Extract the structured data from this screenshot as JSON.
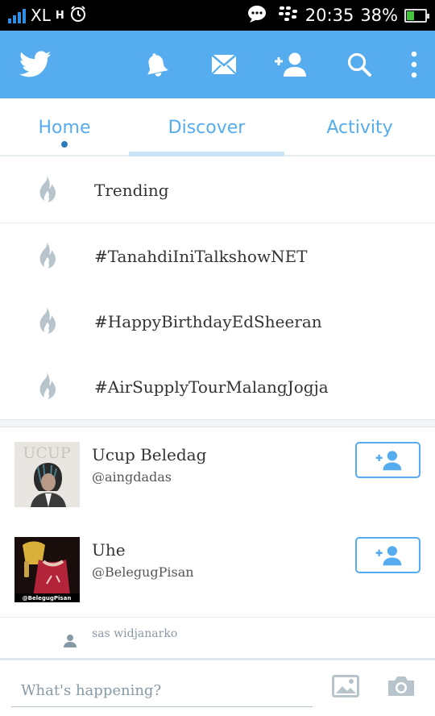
{
  "status_bar": {
    "carrier": "XL",
    "network_type": "H",
    "time": "20:35",
    "battery_percent": "38%",
    "battery_level": 0.38
  },
  "action_bar": {
    "icons": [
      "twitter-bird-icon",
      "bell-icon",
      "envelope-icon",
      "add-user-icon",
      "search-icon",
      "overflow-menu-icon"
    ]
  },
  "tabs": [
    {
      "label": "Home"
    },
    {
      "label": "Discover"
    },
    {
      "label": "Activity"
    }
  ],
  "trending": {
    "header": "Trending",
    "items": [
      "#TanahdiIniTalkshowNET",
      "#HappyBirthdayEdSheeran",
      "#AirSupplyTourMalangJogja"
    ]
  },
  "suggestions": [
    {
      "name": "Ucup Beledag",
      "handle": "@aingdadas",
      "avatar_text": "UCUP"
    },
    {
      "name": "Uhe",
      "handle": "@BelegugPisan",
      "avatar_text": "@BelegugPisan"
    }
  ],
  "more_suggestion": {
    "name": "sas widjanarko"
  },
  "composer": {
    "placeholder": "What's happening?"
  },
  "colors": {
    "brand": "#55acee",
    "tab_underline": "#c8e2f6",
    "icon_gray": "#b8c4cc"
  }
}
